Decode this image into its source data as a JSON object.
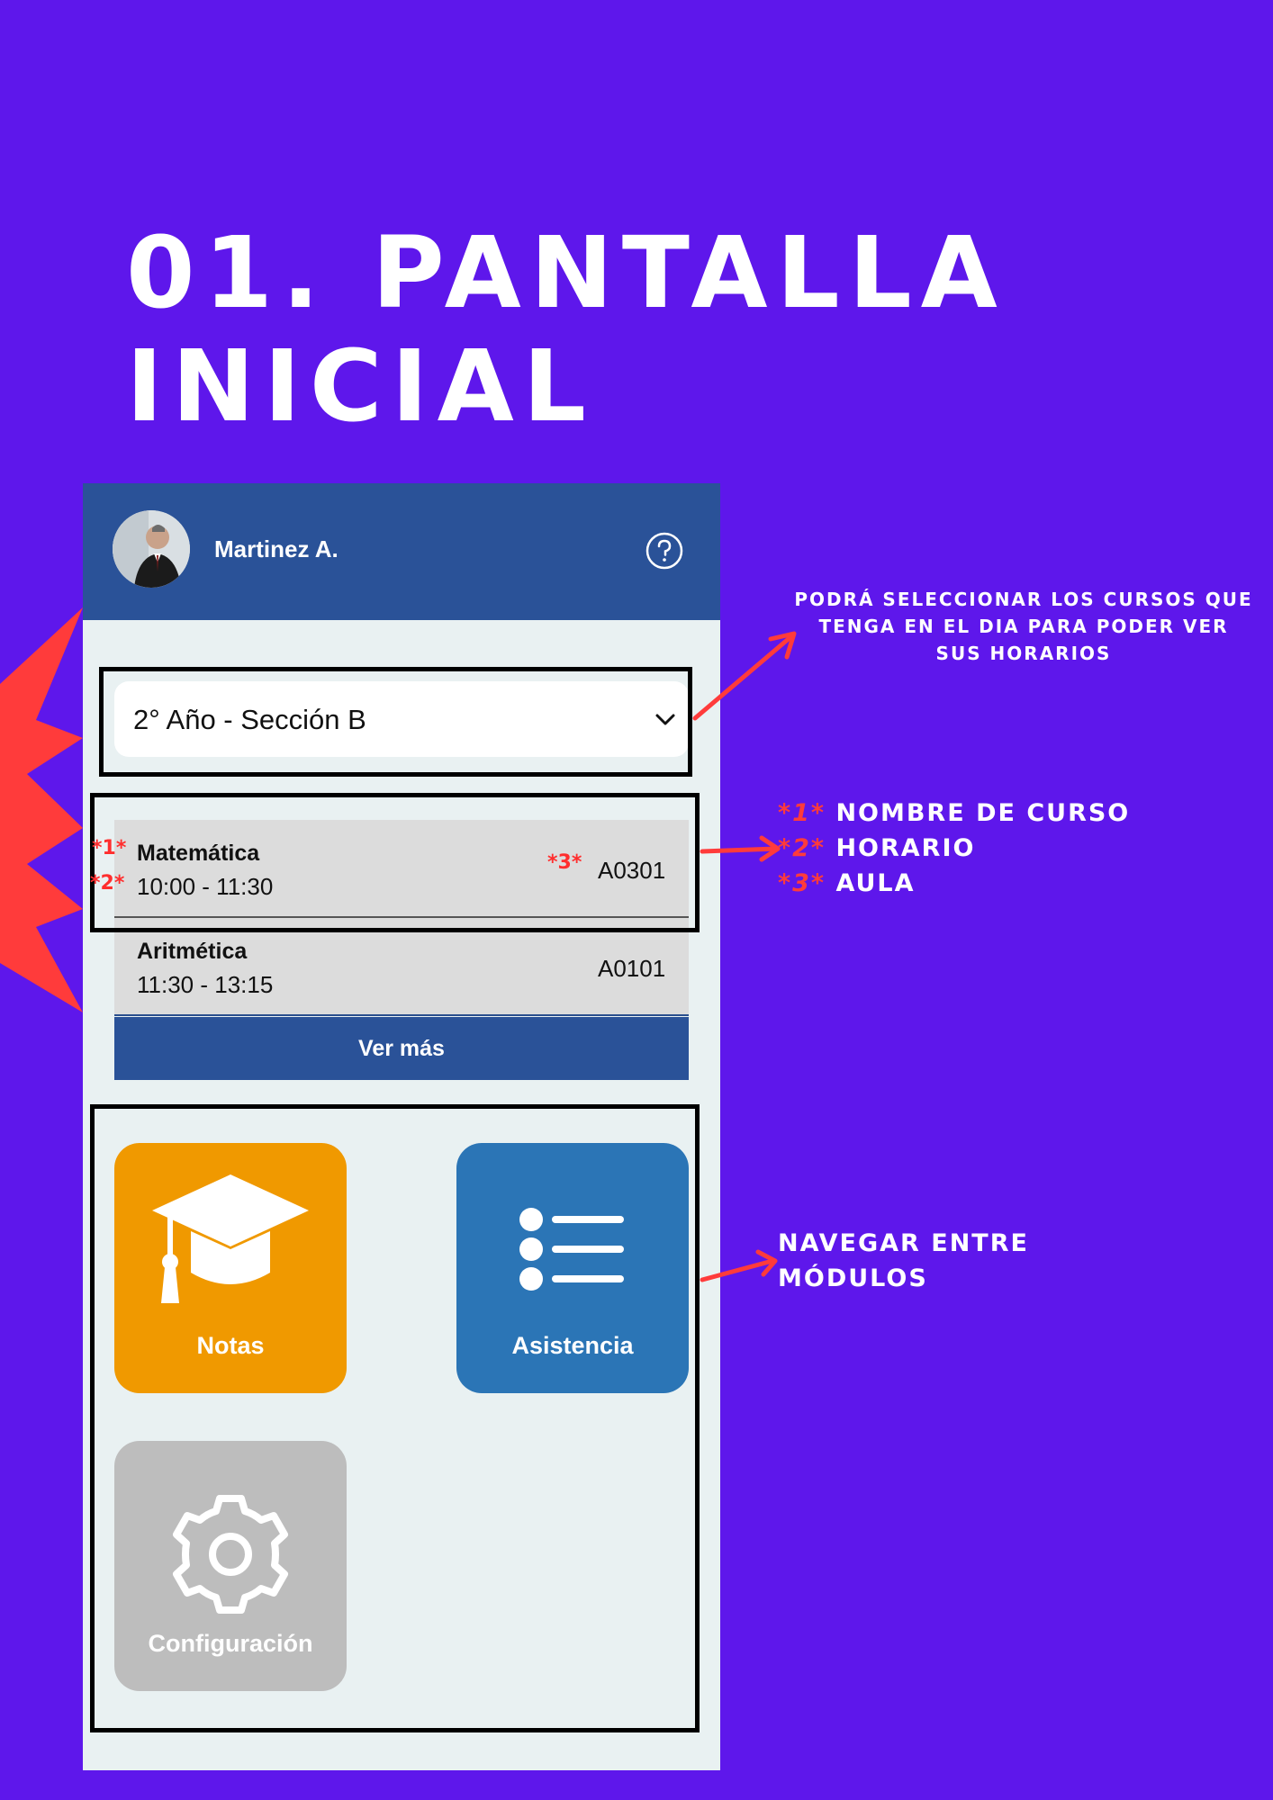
{
  "title": {
    "line1": "01. PANTALLA",
    "line2": "INICIAL"
  },
  "app": {
    "user_name": "Martinez A.",
    "help_icon": "help-circle-icon",
    "section_select": {
      "selected": "2° Año - Sección B",
      "icon": "chevron-down-icon"
    },
    "schedule": [
      {
        "course": "Matemática",
        "time": "10:00 - 11:30",
        "room": "A0301"
      },
      {
        "course": "Aritmética",
        "time": "11:30 - 13:15",
        "room": "A0101"
      }
    ],
    "ver_mas_label": "Ver más",
    "modules": [
      {
        "label": "Notas",
        "icon": "graduation-cap-icon",
        "color": "#f09900"
      },
      {
        "label": "Asistencia",
        "icon": "list-icon",
        "color": "#2b75b6"
      },
      {
        "label": "Configuración",
        "icon": "gear-icon",
        "color": "#bdbdbd"
      }
    ]
  },
  "markers": {
    "m1": "*1*",
    "m2": "*2*",
    "m3": "*3*"
  },
  "annotations": {
    "select_courses": "PODRÁ SELECCIONAR LOS CURSOS QUE TENGA EN EL DIA PARA PODER VER SUS HORARIOS",
    "legend": [
      {
        "mark": "*1*",
        "text": "NOMBRE DE CURSO"
      },
      {
        "mark": "*2*",
        "text": "HORARIO"
      },
      {
        "mark": "*3*",
        "text": "AULA"
      }
    ],
    "navigate_modules": "NAVEGAR ENTRE MÓDULOS"
  },
  "colors": {
    "background": "#5e17eb",
    "app_header": "#2a5298",
    "accent_red": "#ff3b3b"
  }
}
